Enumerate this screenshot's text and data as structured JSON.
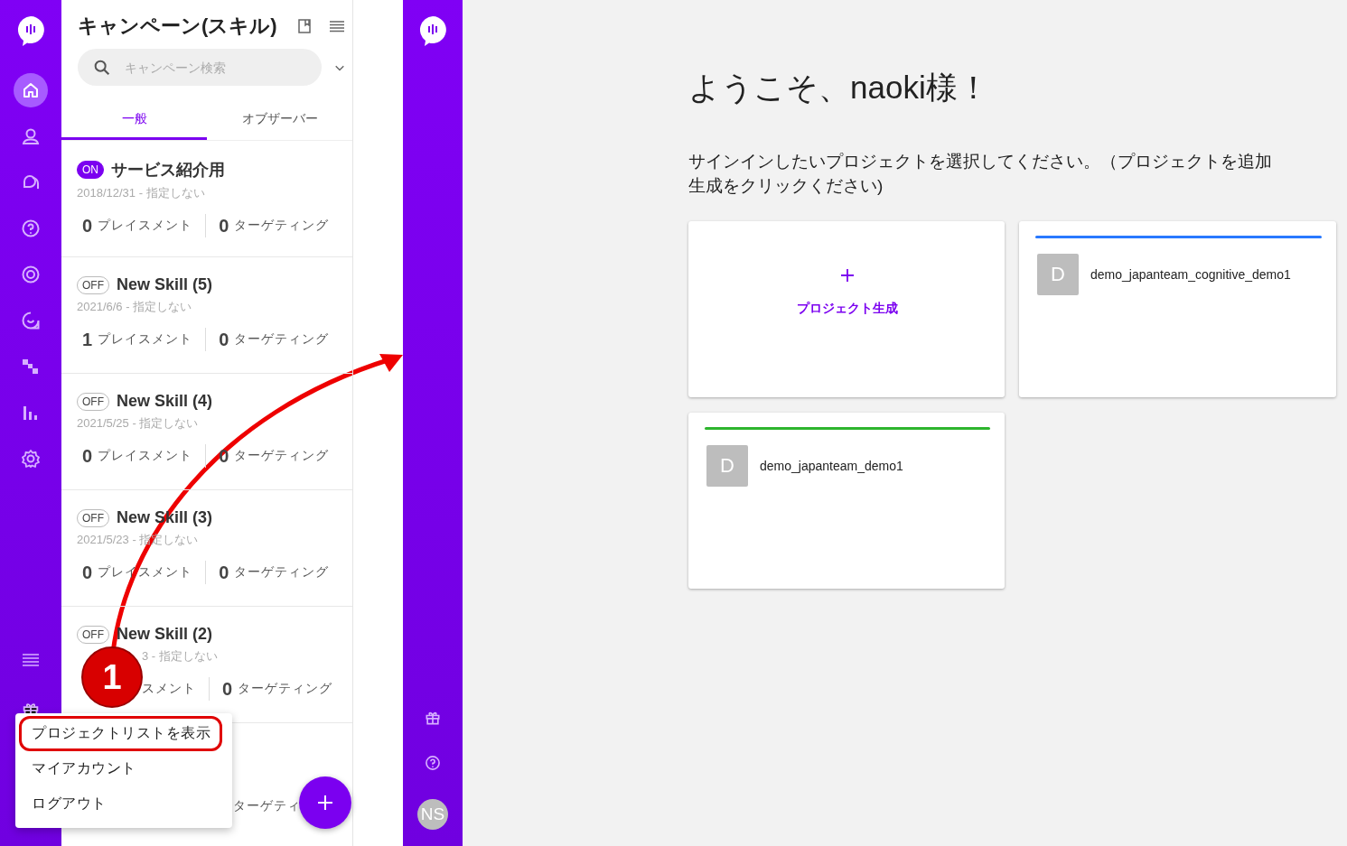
{
  "left_rail": {
    "items": [
      {
        "selected": true
      },
      {
        "selected": false
      },
      {
        "selected": false
      },
      {
        "selected": false
      },
      {
        "selected": false
      },
      {
        "selected": false
      },
      {
        "selected": false
      },
      {
        "selected": false
      },
      {
        "selected": false
      }
    ]
  },
  "campaign_panel": {
    "title": "キャンペーン(スキル)",
    "search": {
      "placeholder": "キャンペーン検索"
    },
    "tabs": [
      {
        "label": "一般",
        "selected": true
      },
      {
        "label": "オブザーバー",
        "selected": false
      }
    ],
    "campaigns": [
      {
        "on": true,
        "badge": "ON",
        "title": "サービス紹介用",
        "date": "2018/12/31 - 指定しない",
        "placements": "0",
        "placements_label": "プレイスメント",
        "targeting": "0",
        "targeting_label": "ターゲティング"
      },
      {
        "on": false,
        "badge": "OFF",
        "title": "New Skill (5)",
        "date": "2021/6/6 - 指定しない",
        "placements": "1",
        "placements_label": "プレイスメント",
        "targeting": "0",
        "targeting_label": "ターゲティング"
      },
      {
        "on": false,
        "badge": "OFF",
        "title": "New Skill (4)",
        "date": "2021/5/25 - 指定しない",
        "placements": "0",
        "placements_label": "プレイスメント",
        "targeting": "0",
        "targeting_label": "ターゲティング"
      },
      {
        "on": false,
        "badge": "OFF",
        "title": "New Skill (3)",
        "date": "2021/5/23 - 指定しない",
        "placements": "0",
        "placements_label": "プレイスメント",
        "targeting": "0",
        "targeting_label": "ターゲティング"
      },
      {
        "on": false,
        "badge": "OFF",
        "title": "New Skill (2)",
        "kind": "covered",
        "date": "3 - 指定しない",
        "placements_label": "スメント",
        "targeting": "0",
        "targeting_label": "ターゲティング"
      }
    ],
    "partial_row": {
      "targeting_label": "ターゲティ"
    }
  },
  "popup_menu": {
    "items": [
      {
        "label": "プロジェクトリストを表示",
        "highlighted": true
      },
      {
        "label": "マイアカウント",
        "highlighted": false
      },
      {
        "label": "ログアウト",
        "highlighted": false
      }
    ]
  },
  "annotation": {
    "step": "1"
  },
  "welcome": {
    "heading": "ようこそ、naoki様！",
    "instruction_lines": [
      "サインインしたいプロジェクトを選択してください。（プロジェクトを追加",
      "生成をクリックください)"
    ],
    "new_project": {
      "label": "プロジェクト生成"
    },
    "projects": [
      {
        "initial": "D",
        "name": "demo_japanteam_cognitive_demo1",
        "color": "#2979ff"
      },
      {
        "initial": "D",
        "name": "demo_japanteam_demo1",
        "color": "#2db52d"
      }
    ]
  },
  "right_rail": {
    "avatar": "NS"
  }
}
